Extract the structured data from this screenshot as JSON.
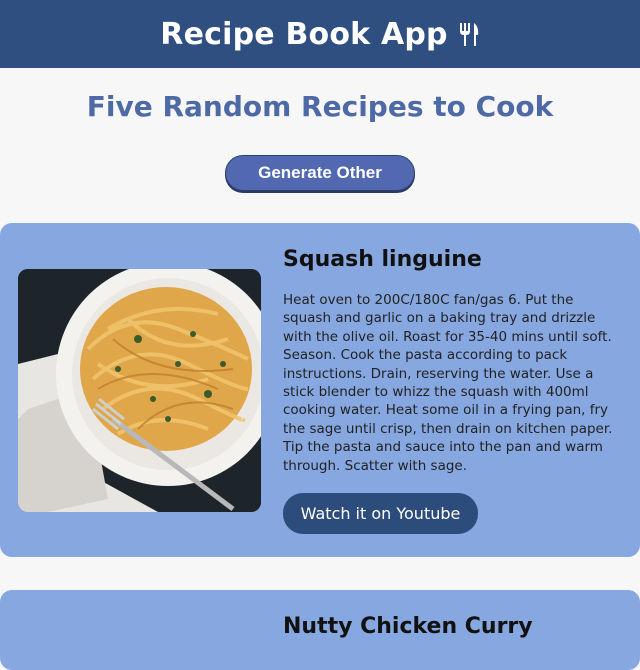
{
  "header": {
    "title": "Recipe Book App",
    "icon": "fork-knife-icon"
  },
  "main": {
    "subtitle": "Five Random Recipes to Cook",
    "generate_label": "Generate Other"
  },
  "recipes": [
    {
      "title": "Squash linguine",
      "instructions": "Heat oven to 200C/180C fan/gas 6. Put the squash and garlic on a baking tray and drizzle with the olive oil. Roast for 35-40 mins until soft. Season. Cook the pasta according to pack instructions. Drain, reserving the water. Use a stick blender to whizz the squash with 400ml cooking water. Heat some oil in a frying pan, fry the sage until crisp, then drain on kitchen paper. Tip the pasta and sauce into the pan and warm through. Scatter with sage.",
      "youtube_label": "Watch it on Youtube"
    },
    {
      "title": "Nutty Chicken Curry"
    }
  ],
  "colors": {
    "header_bg": "#2f4f80",
    "card_bg": "#86a7e0",
    "accent": "#5268b0"
  }
}
